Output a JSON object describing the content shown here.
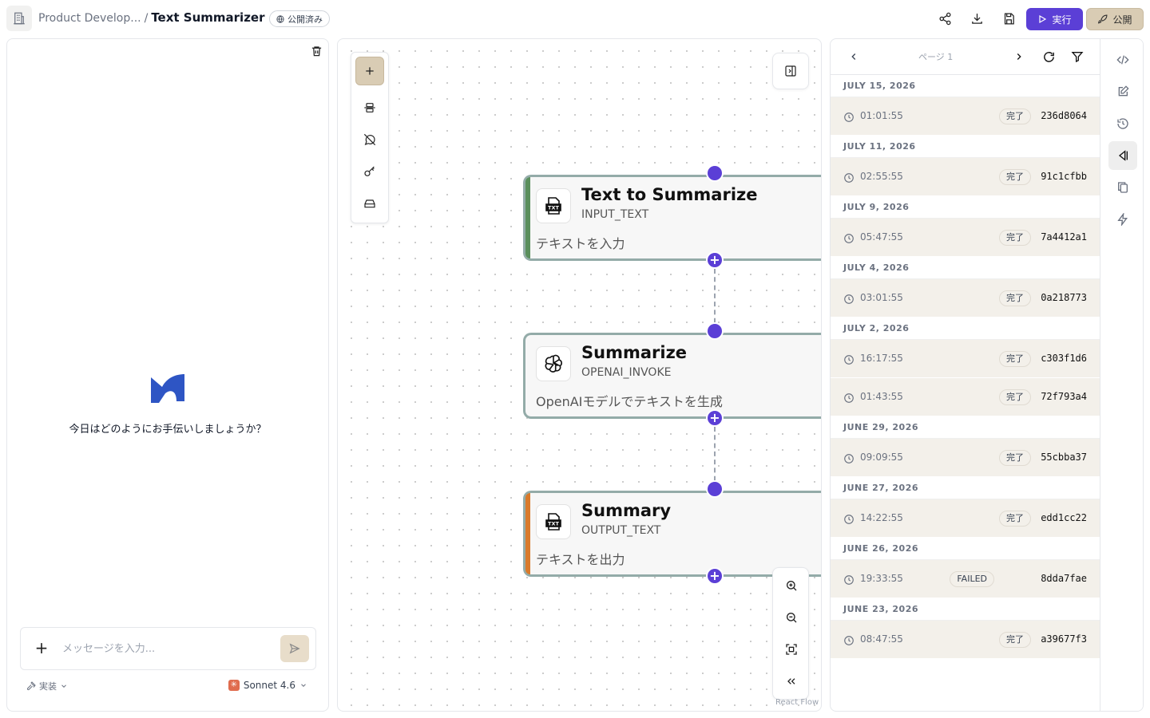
{
  "header": {
    "project": "Product Develop...",
    "separator": "/",
    "app_title": "Text Summarizer",
    "published_badge": "公開済み",
    "run_label": "実行",
    "publish_label": "公開"
  },
  "chat": {
    "welcome": "今日はどのようにお手伝いしましょうか？",
    "input_placeholder": "メッセージを入力...",
    "mode_label": "実装",
    "model_label": "Sonnet 4.6",
    "model_badge": "✳"
  },
  "canvas": {
    "attribution": "React Flow",
    "nodes": [
      {
        "title": "Text to Summarize",
        "type": "INPUT_TEXT",
        "description": "テキストを入力",
        "accent": "#5a8f5c",
        "icon": "txt-file-icon"
      },
      {
        "title": "Summarize",
        "type": "OPENAI_INVOKE",
        "description": "OpenAIモデルでテキストを生成",
        "accent": "",
        "icon": "openai-icon"
      },
      {
        "title": "Summary",
        "type": "OUTPUT_TEXT",
        "description": "テキストを出力",
        "accent": "#d97a2b",
        "icon": "txt-file-icon"
      }
    ]
  },
  "history": {
    "page_label": "ページ 1",
    "groups": [
      {
        "date": "JULY 15, 2026",
        "runs": [
          {
            "time": "01:01:55",
            "status": "完了",
            "id": "236d8064"
          }
        ]
      },
      {
        "date": "JULY 11, 2026",
        "runs": [
          {
            "time": "02:55:55",
            "status": "完了",
            "id": "91c1cfbb"
          }
        ]
      },
      {
        "date": "JULY 9, 2026",
        "runs": [
          {
            "time": "05:47:55",
            "status": "完了",
            "id": "7a4412a1"
          }
        ]
      },
      {
        "date": "JULY 4, 2026",
        "runs": [
          {
            "time": "03:01:55",
            "status": "完了",
            "id": "0a218773"
          }
        ]
      },
      {
        "date": "JULY 2, 2026",
        "runs": [
          {
            "time": "16:17:55",
            "status": "完了",
            "id": "c303f1d6"
          },
          {
            "time": "01:43:55",
            "status": "完了",
            "id": "72f793a4"
          }
        ]
      },
      {
        "date": "JUNE 29, 2026",
        "runs": [
          {
            "time": "09:09:55",
            "status": "完了",
            "id": "55cbba37"
          }
        ]
      },
      {
        "date": "JUNE 27, 2026",
        "runs": [
          {
            "time": "14:22:55",
            "status": "完了",
            "id": "edd1cc22"
          }
        ]
      },
      {
        "date": "JUNE 26, 2026",
        "runs": [
          {
            "time": "19:33:55",
            "status": "FAILED",
            "id": "8dda7fae"
          }
        ]
      },
      {
        "date": "JUNE 23, 2026",
        "runs": [
          {
            "time": "08:47:55",
            "status": "完了",
            "id": "a39677f3"
          }
        ]
      }
    ]
  },
  "colors": {
    "primary": "#5b3fd6",
    "accent_tan": "#d9ccb4",
    "node_border": "#93aba8",
    "run_row_bg": "#f3f0ea"
  }
}
